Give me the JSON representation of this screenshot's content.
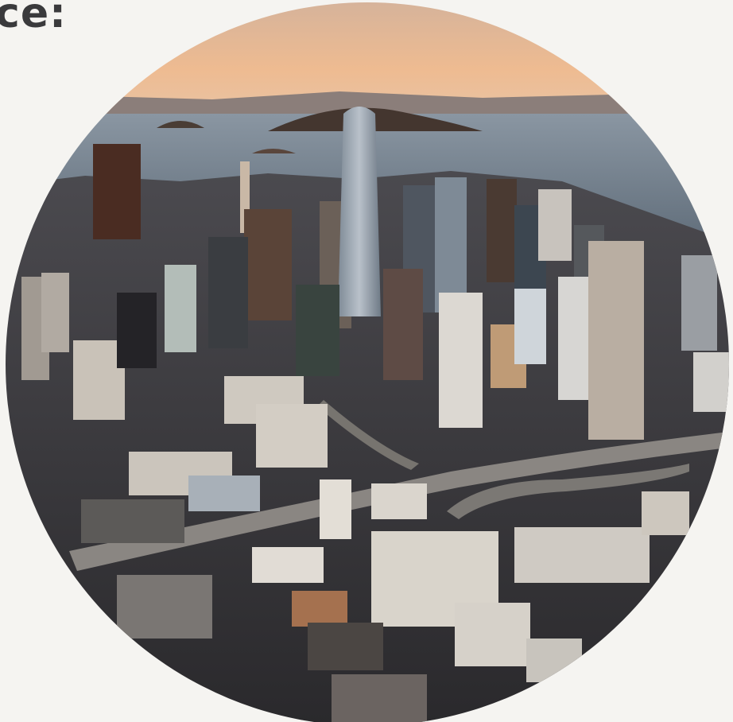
{
  "section": {
    "heading_fragment": "ce:"
  },
  "photo": {
    "icon": "city-skyline-photo",
    "colors": {
      "sky_top": "#d9b79a",
      "sky_horizon": "#f0b98c",
      "water": "#6f7c8a",
      "hills": "#3f3631",
      "tower": "#9aa3ad",
      "city_shadow": "#2f2d2f",
      "city_light": "#c9c3ba"
    }
  }
}
